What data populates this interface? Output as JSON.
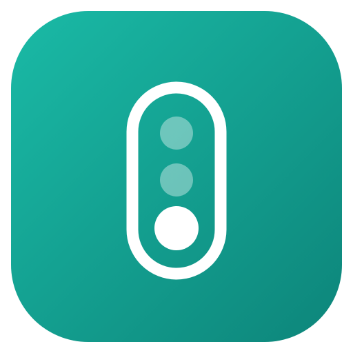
{
  "app_icon": {
    "icon": "traffic-light-icon",
    "colors": {
      "background_gradient_start": "#1abaa6",
      "background_gradient_end": "#0d857a",
      "foreground": "#ffffff"
    },
    "lights": [
      {
        "name": "top-light",
        "state": "dim"
      },
      {
        "name": "middle-light",
        "state": "dim"
      },
      {
        "name": "bottom-light",
        "state": "lit"
      }
    ]
  }
}
